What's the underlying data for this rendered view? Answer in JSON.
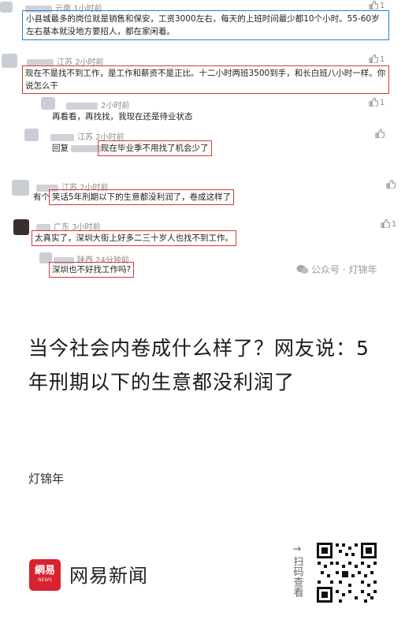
{
  "comments": [
    {
      "location": "云南",
      "time": "1小时前",
      "likes": "1",
      "text": "小县城最多的岗位就是销售和保安，工资3000左右，每天的上班时间最少都10个小时。55-60岁左右基本就没地方要招人，都在家闲着。"
    },
    {
      "location": "江苏",
      "time": "2小时前",
      "likes": "1",
      "text": "现在不是找不到工作，是工作和薪资不是正比。十二小时两班3500到手，和长白班八小时一样。你说怎么干"
    },
    {
      "location": "",
      "time": "2小时前",
      "likes": "1",
      "text": "再看看，再找找，我现在还是待业状态"
    },
    {
      "location": "江苏",
      "time": "2小时前",
      "likes": "",
      "reply_prefix": "回复",
      "text": "现在毕业季不用找了机会少了"
    },
    {
      "location": "江苏",
      "time": "2小时前",
      "likes": "",
      "prefix": "有个",
      "text": "笑话5年刑期以下的生意都没利润了，卷成这样了"
    },
    {
      "location": "广东",
      "time": "3小时前",
      "likes": "1",
      "text": "太真实了，深圳大街上好多二三十岁人也找不到工作。"
    },
    {
      "location": "陕西",
      "time": "24分钟前",
      "likes": "",
      "text": "深圳也不好找工作吗?"
    }
  ],
  "watermark": "公众号 · 灯锦年",
  "article": {
    "title": "当今社会内卷成什么样了？网友说：5年刑期以下的生意都没利润了",
    "author": "灯锦年"
  },
  "footer": {
    "logo_text": "網易",
    "logo_sub": "NEWS",
    "brand": "网易新闻",
    "scan_arrow": "→",
    "scan_text": "扫码查看"
  },
  "colors": {
    "highlight_red": "#d23a3a",
    "highlight_blue": "#2b7fc4",
    "brand_red": "#d9232e"
  }
}
